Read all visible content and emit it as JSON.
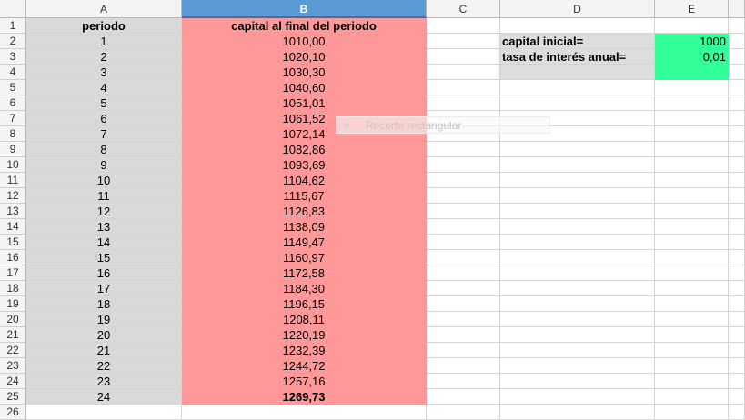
{
  "columns": [
    "A",
    "B",
    "C",
    "D",
    "E"
  ],
  "selected_column": "B",
  "row_numbers": [
    "1",
    "2",
    "3",
    "4",
    "5",
    "6",
    "7",
    "8",
    "9",
    "10",
    "11",
    "12",
    "13",
    "14",
    "15",
    "16",
    "17",
    "18",
    "19",
    "20",
    "21",
    "22",
    "23",
    "24",
    "25",
    "26"
  ],
  "headers": {
    "periodo": "periodo",
    "capital": "capital  al final del periodo"
  },
  "periods": [
    "1",
    "2",
    "3",
    "4",
    "5",
    "6",
    "7",
    "8",
    "9",
    "10",
    "11",
    "12",
    "13",
    "14",
    "15",
    "16",
    "17",
    "18",
    "19",
    "20",
    "21",
    "22",
    "23",
    "24"
  ],
  "capital_values": [
    "1010,00",
    "1020,10",
    "1030,30",
    "1040,60",
    "1051,01",
    "1061,52",
    "1072,14",
    "1082,86",
    "1093,69",
    "1104,62",
    "1115,67",
    "1126,83",
    "1138,09",
    "1149,47",
    "1160,97",
    "1172,58",
    "1184,30",
    "1196,15",
    "1208,11",
    "1220,19",
    "1232,39",
    "1244,72",
    "1257,16",
    "1269,73"
  ],
  "params": [
    {
      "label": "capital inicial=",
      "value": "1000"
    },
    {
      "label": "tasa de interés anual=",
      "value": "0,01"
    }
  ],
  "overlay_text": "Recorte rectangular",
  "colors": {
    "column_a": "#d9d9d9",
    "column_b": "#ff9999",
    "param_labels": "#dddddd",
    "param_values": "#33ff99",
    "selected_header": "#5a9bd6"
  }
}
